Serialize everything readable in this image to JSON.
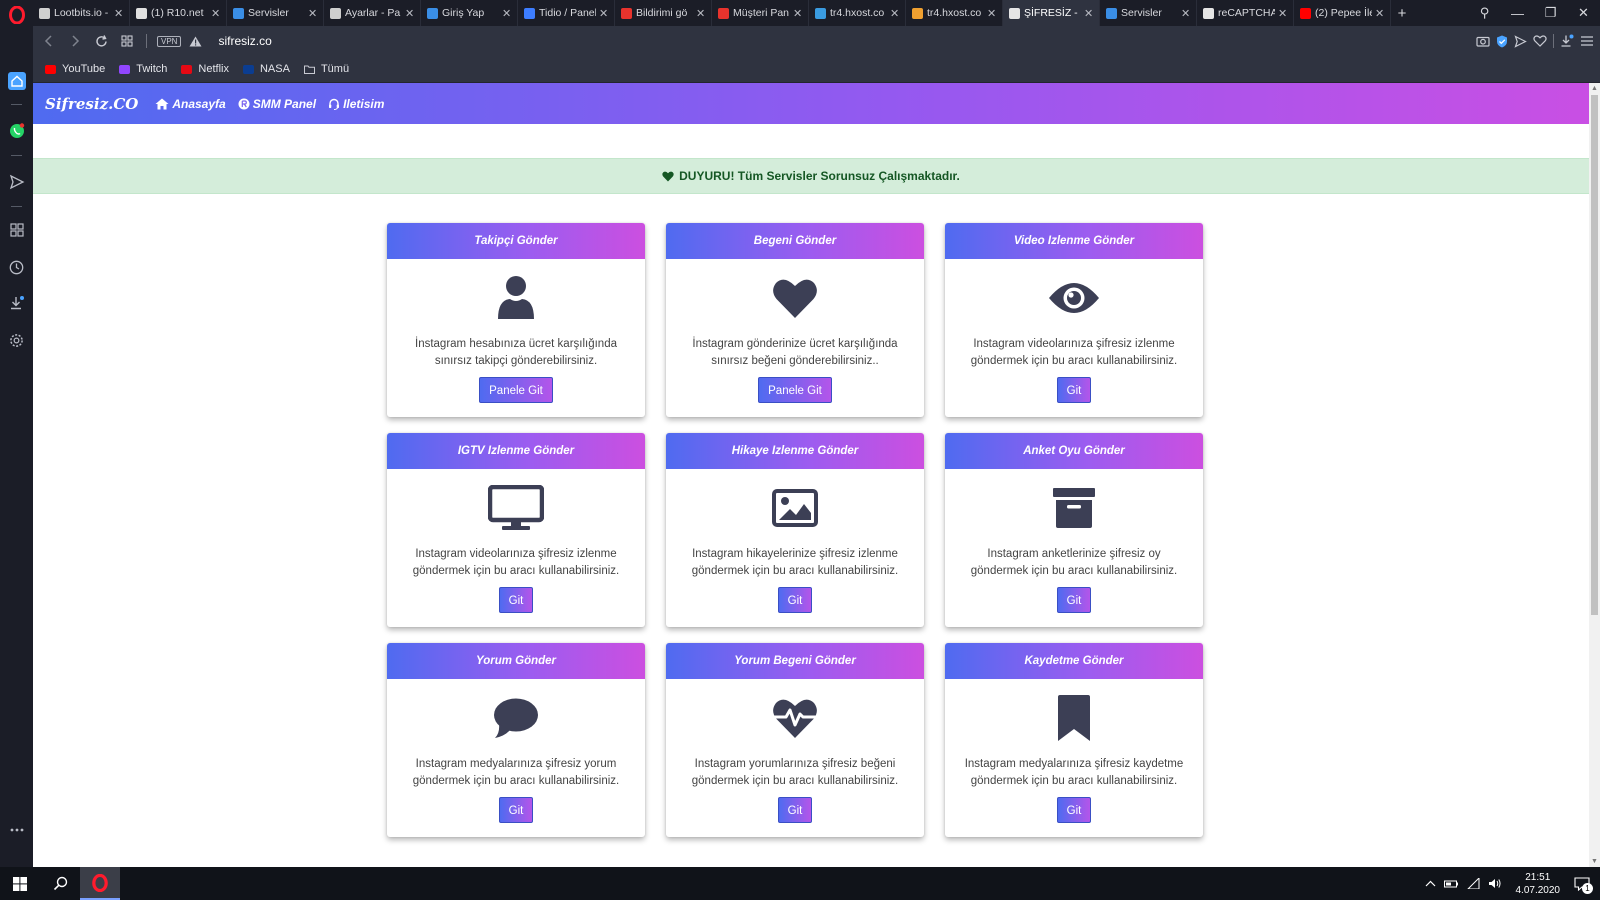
{
  "browser": {
    "tabs": [
      {
        "title": "Lootbits.io -",
        "color": "#d0d0d0"
      },
      {
        "title": "(1) R10.net",
        "color": "#e0e0e0"
      },
      {
        "title": "Servisler",
        "color": "#3a8ee6"
      },
      {
        "title": "Ayarlar - Pa",
        "color": "#cfcfcf"
      },
      {
        "title": "Giriş Yap",
        "color": "#3a8ee6"
      },
      {
        "title": "Tidio / Panel",
        "color": "#3d7dff"
      },
      {
        "title": "Bildirimi gö",
        "color": "#e8332d"
      },
      {
        "title": "Müşteri Pan",
        "color": "#e8332d"
      },
      {
        "title": "tr4.hxost.co",
        "color": "#3a9be0"
      },
      {
        "title": "tr4.hxost.co",
        "color": "#f0a030"
      },
      {
        "title": "ŞİFRESİZ - Ş",
        "color": "#e5e5e5"
      },
      {
        "title": "Servisler",
        "color": "#3a8ee6"
      },
      {
        "title": "reCAPTCHA",
        "color": "#e5e5e5"
      },
      {
        "title": "(2) Pepee İle",
        "color": "#ff0000"
      }
    ],
    "active_tab_index": 10,
    "vpn_label": "VPN",
    "url": "sifresiz.co",
    "bookmarks": [
      {
        "label": "YouTube",
        "color": "#ff0000"
      },
      {
        "label": "Twitch",
        "color": "#9146ff"
      },
      {
        "label": "Netflix",
        "color": "#e50914"
      },
      {
        "label": "NASA",
        "color": "#0b3d91"
      },
      {
        "label": "Tümü",
        "color": "#c8cad2"
      }
    ]
  },
  "site": {
    "brand": "Sifresiz.CO",
    "nav": [
      {
        "label": "Anasayfa",
        "icon": "home-icon"
      },
      {
        "label": "SMM Panel",
        "icon": "smm-icon"
      },
      {
        "label": "Iletisim",
        "icon": "headset-icon"
      }
    ],
    "announcement": "DUYURU! Tüm Servisler Sorunsuz Çalışmaktadır."
  },
  "cards": [
    {
      "title": "Takipçi Gönder",
      "icon": "user-icon",
      "text": "İnstagram hesabınıza ücret karşılığında sınırsız takipçi gönderebilirsiniz.",
      "button": "Panele Git"
    },
    {
      "title": "Begeni Gönder",
      "icon": "heart-icon",
      "text": "İnstagram gönderinize ücret karşılığında sınırsız beğeni gönderebilirsiniz..",
      "button": "Panele Git"
    },
    {
      "title": "Video Izlenme Gönder",
      "icon": "eye-icon",
      "text": "Instagram videolarınıza şifresiz izlenme göndermek için bu aracı kullanabilirsiniz.",
      "button": "Git"
    },
    {
      "title": "IGTV Izlenme Gönder",
      "icon": "monitor-icon",
      "text": "Instagram videolarınıza şifresiz izlenme göndermek için bu aracı kullanabilirsiniz.",
      "button": "Git"
    },
    {
      "title": "Hikaye Izlenme Gönder",
      "icon": "image-icon",
      "text": "Instagram hikayelerinize şifresiz izlenme göndermek için bu aracı kullanabilirsiniz.",
      "button": "Git"
    },
    {
      "title": "Anket Oyu Gönder",
      "icon": "archive-icon",
      "text": "Instagram anketlerinize şifresiz oy göndermek için bu aracı kullanabilirsiniz.",
      "button": "Git"
    },
    {
      "title": "Yorum Gönder",
      "icon": "comment-icon",
      "text": "Instagram medyalarınıza şifresiz yorum göndermek için bu aracı kullanabilirsiniz.",
      "button": "Git"
    },
    {
      "title": "Yorum Begeni Gönder",
      "icon": "heartbeat-icon",
      "text": "Instagram yorumlarınıza şifresiz beğeni göndermek için bu aracı kullanabilirsiniz.",
      "button": "Git"
    },
    {
      "title": "Kaydetme Gönder",
      "icon": "bookmark-icon",
      "text": "Instagram medyalarınıza şifresiz kaydetme göndermek için bu aracı kullanabilirsiniz.",
      "button": "Git"
    }
  ],
  "taskbar": {
    "time": "21:51",
    "date": "4.07.2020",
    "notification_count": "1"
  },
  "colors": {
    "gradient_start": "#4f6bf0",
    "gradient_end": "#c94fe4",
    "icon_color": "#3c3f55",
    "announce_bg": "#d4edda",
    "announce_text": "#155724"
  }
}
